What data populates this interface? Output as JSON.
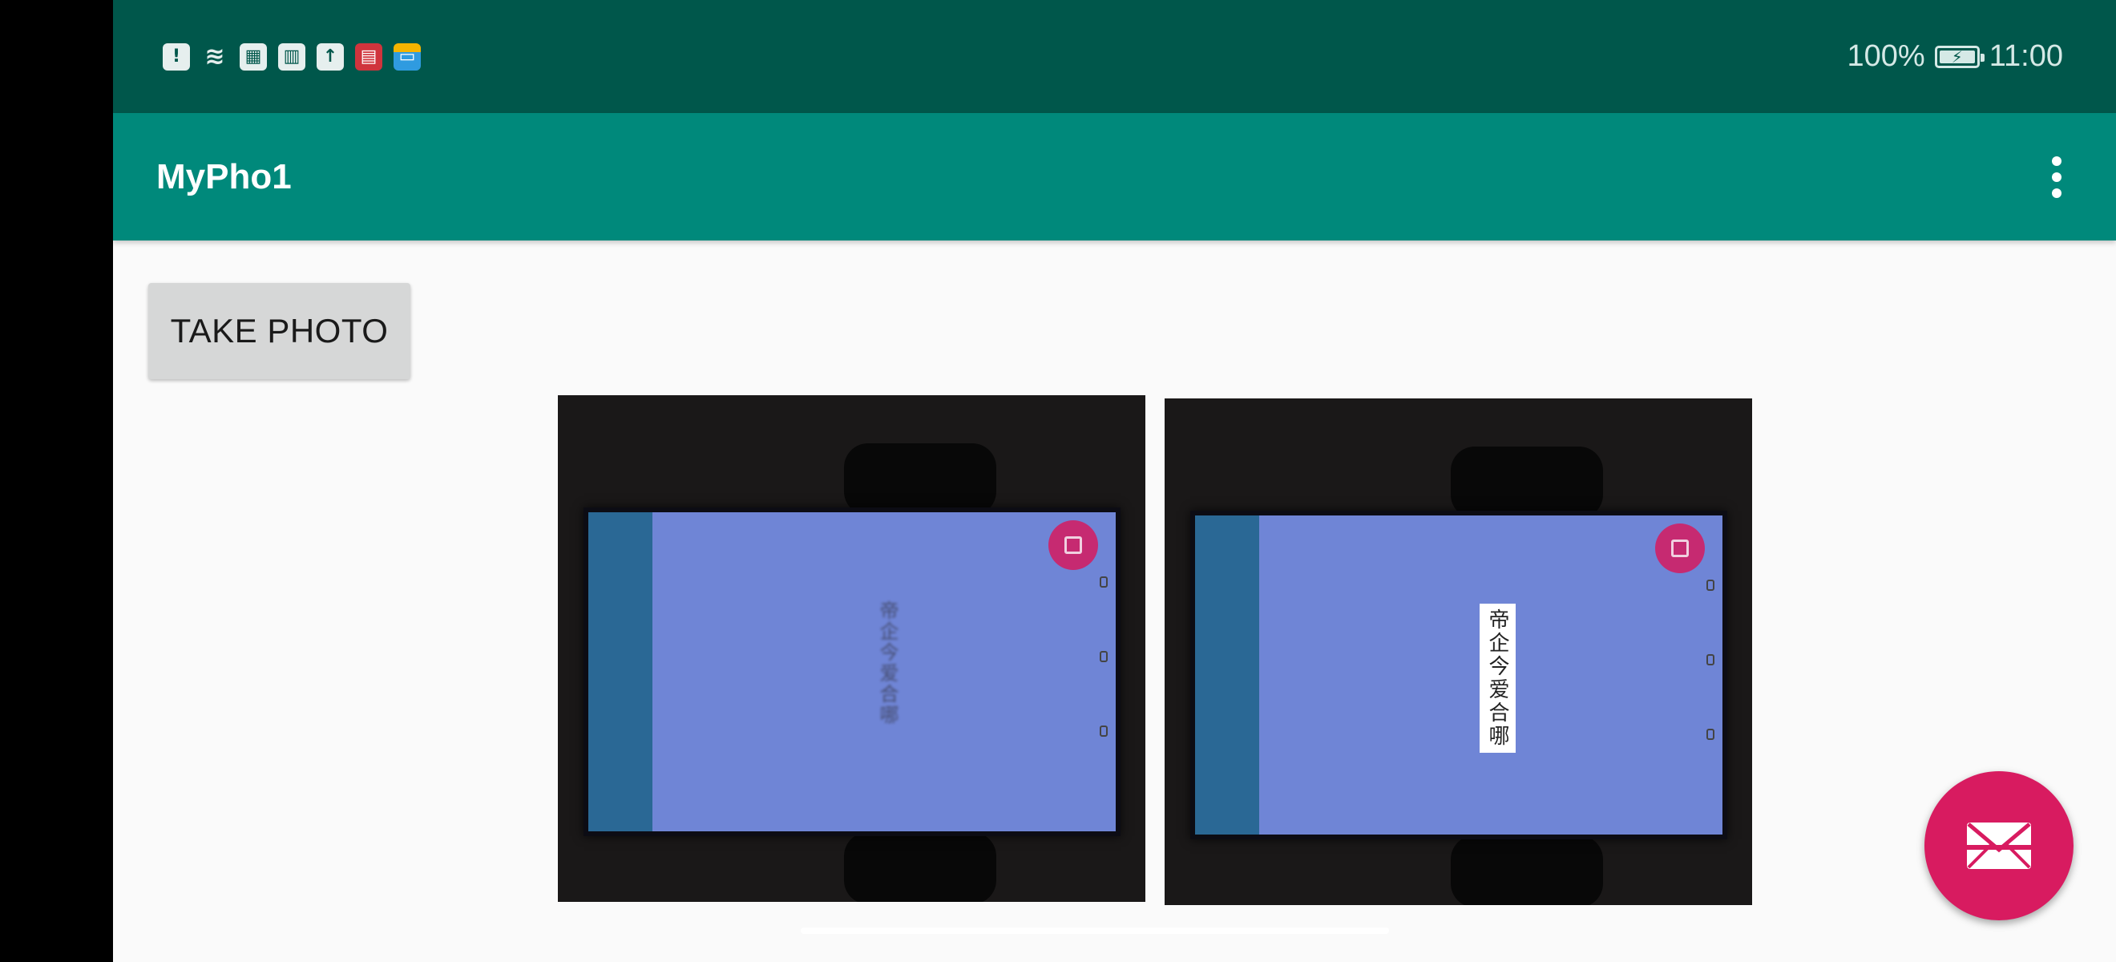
{
  "status_bar": {
    "icons": [
      "sim-alert-icon",
      "wifi-icon",
      "huawei-icon",
      "trash-icon",
      "upload-icon",
      "book-icon",
      "wallet-icon"
    ],
    "icon_glyphs": [
      "!",
      "≋",
      "▦",
      "▥",
      "↑",
      "▤",
      "▭"
    ],
    "battery_percent": "100%",
    "time": "11:00"
  },
  "app_bar": {
    "title": "MyPho1",
    "menu_icon": "overflow-menu-icon"
  },
  "main": {
    "take_photo_label": "TAKE PHOTO",
    "photos": [
      {
        "name": "original-photo",
        "screen_text": "帝企今爱合哪",
        "text_style": "blurred"
      },
      {
        "name": "processed-photo",
        "screen_text": "帝企今爱合哪",
        "text_style": "crisp"
      }
    ],
    "fab_icon": "mail-icon"
  },
  "colors": {
    "status_bar": "#00574b",
    "app_bar": "#00897b",
    "fab": "#d81b60",
    "background": "#fafafa"
  }
}
